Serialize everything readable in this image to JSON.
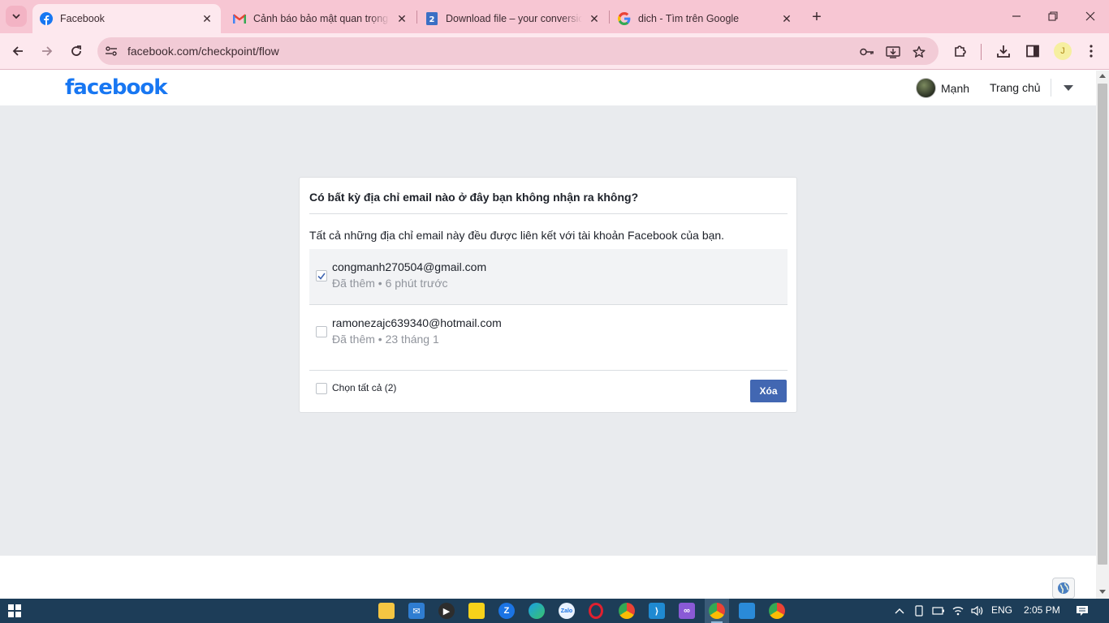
{
  "browser": {
    "tabs": [
      {
        "title": "Facebook",
        "icon": "facebook-icon",
        "active": true
      },
      {
        "title": "Cảnh báo bảo mật quan trọng",
        "icon": "gmail-icon",
        "active": false
      },
      {
        "title": "Download file – your conversion",
        "icon": "convert-site-icon",
        "active": false
      },
      {
        "title": "dich - Tìm trên Google",
        "icon": "google-icon",
        "active": false
      }
    ],
    "url": "facebook.com/checkpoint/flow",
    "profile_initial": "J",
    "accent_color": "#f7c6d3"
  },
  "fb": {
    "logo": "facebook",
    "user_name": "Mạnh",
    "home_link": "Trang chủ",
    "brand_color": "#1877f2",
    "card": {
      "title": "Có bất kỳ địa chỉ email nào ở đây bạn không nhận ra không?",
      "description": "Tất cả những địa chỉ email này đều được liên kết với tài khoản Facebook của bạn.",
      "emails": [
        {
          "address": "congmanh270504@gmail.com",
          "meta": "Đã thêm • 6 phút trước",
          "checked": true
        },
        {
          "address": "ramonezajc639340@hotmail.com",
          "meta": "Đã thêm • 23 tháng 1",
          "checked": false
        }
      ],
      "select_all": "Chọn tất cả (2)",
      "delete_button": "Xóa",
      "button_color": "#4267b2"
    }
  },
  "taskbar": {
    "apps": [
      "file-explorer-icon",
      "mail-icon",
      "media-player-icon",
      "sticky-notes-icon",
      "zalo-z-icon",
      "edge-icon",
      "zalo-icon",
      "opera-icon",
      "chrome-icon",
      "vscode-icon",
      "visual-studio-icon",
      "chrome-active-icon",
      "photos-icon",
      "chrome-2-icon"
    ],
    "language": "ENG",
    "time": "2:05 PM"
  }
}
